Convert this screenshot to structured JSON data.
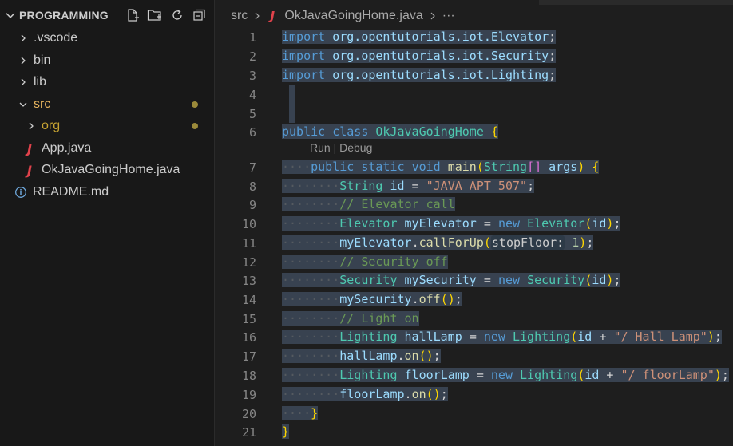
{
  "explorer": {
    "folder_title": "PROGRAMMING",
    "actions": [
      "new-file-icon",
      "new-folder-icon",
      "refresh-icon",
      "collapse-all-icon"
    ],
    "items": [
      {
        "label": ".vscode",
        "type": "folder",
        "expanded": false
      },
      {
        "label": "bin",
        "type": "folder",
        "expanded": false
      },
      {
        "label": "lib",
        "type": "folder",
        "expanded": false
      },
      {
        "label": "src",
        "type": "folder",
        "expanded": true,
        "modified": true
      },
      {
        "label": "org",
        "type": "folder",
        "expanded": false,
        "modified": true
      },
      {
        "label": "App.java",
        "type": "java"
      },
      {
        "label": "OkJavaGoingHome.java",
        "type": "java"
      },
      {
        "label": "README.md",
        "type": "info"
      }
    ],
    "colors": {
      "modified_text": "#c6a332",
      "src_text": "#e5b35e",
      "java_icon": "#e0424b"
    }
  },
  "breadcrumb": {
    "folder": "src",
    "file": "OkJavaGoingHome.java",
    "more": "···"
  },
  "editor": {
    "codelens": "Run | Debug",
    "line_numbers": [
      "1",
      "2",
      "3",
      "4",
      "5",
      "6",
      "7",
      "8",
      "9",
      "10",
      "11",
      "12",
      "13",
      "14",
      "15",
      "16",
      "17",
      "18",
      "19",
      "20",
      "21"
    ],
    "lines": [
      "import org.opentutorials.iot.Elevator;",
      "import org.opentutorials.iot.Security;",
      "import org.opentutorials.iot.Lighting;",
      "",
      "",
      "public class OkJavaGoingHome {",
      "    public static void main(String[] args) {",
      "        String id = \"JAVA APT 507\";",
      "        // Elevator call",
      "        Elevator myElevator = new Elevator(id);",
      "        myElevator.callForUp(stopFloor: 1);",
      "        // Security off",
      "        Security mySecurity = new Security(id);",
      "        mySecurity.off();",
      "        // Light on",
      "        Lighting hallLamp = new Lighting(id + \"/ Hall Lamp\");",
      "        hallLamp.on();",
      "        Lighting floorLamp = new Lighting(id + \"/ floorLamp\");",
      "        floorLamp.on();",
      "    }",
      "}"
    ],
    "inlay_hint": "stopFloor:",
    "selection_color": "#384250"
  }
}
